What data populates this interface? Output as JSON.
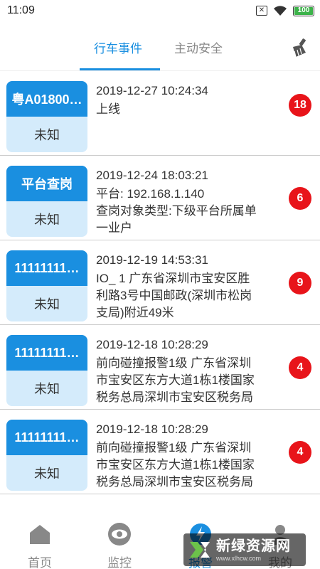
{
  "status_bar": {
    "time": "11:09",
    "battery": "100"
  },
  "tabs": [
    {
      "label": "行车事件",
      "active": true
    },
    {
      "label": "主动安全",
      "active": false
    }
  ],
  "colors": {
    "accent": "#1a8fe0",
    "badge": "#e8141a",
    "card_bg": "#d4ebfb"
  },
  "events": [
    {
      "plate": "粤A01800…",
      "status": "未知",
      "time": "2019-12-27 10:24:34",
      "lines": [
        "上线"
      ],
      "count": "18"
    },
    {
      "plate": "平台查岗",
      "status": "未知",
      "time": "2019-12-24 18:03:21",
      "lines": [
        "平台: 192.168.1.140",
        "查岗对象类型:下级平台所属单",
        "一业户"
      ],
      "count": "6"
    },
    {
      "plate": "11111111…",
      "status": "未知",
      "time": "2019-12-19 14:53:31",
      "lines": [
        "IO_ 1 广东省深圳市宝安区胜",
        "利路3号中国邮政(深圳市松岗",
        "支局)附近49米"
      ],
      "count": "9"
    },
    {
      "plate": "11111111…",
      "status": "未知",
      "time": "2019-12-18 10:28:29",
      "lines": [
        "前向碰撞报警1级 广东省深圳",
        "市宝安区东方大道1栋1楼国家",
        "税务总局深圳市宝安区税务局"
      ],
      "count": "4"
    },
    {
      "plate": "11111111…",
      "status": "未知",
      "time": "2019-12-18 10:28:29",
      "lines": [
        "前向碰撞报警1级 广东省深圳",
        "市宝安区东方大道1栋1楼国家",
        "税务总局深圳市宝安区税务局"
      ],
      "count": "4"
    }
  ],
  "nav": [
    {
      "label": "首页",
      "icon": "home-icon"
    },
    {
      "label": "监控",
      "icon": "eye-icon"
    },
    {
      "label": "报警",
      "icon": "alarm-icon",
      "active": true
    },
    {
      "label": "我的",
      "icon": "user-icon"
    }
  ],
  "watermark": {
    "title": "新绿资源网",
    "url": "www.xlhcw.com"
  }
}
